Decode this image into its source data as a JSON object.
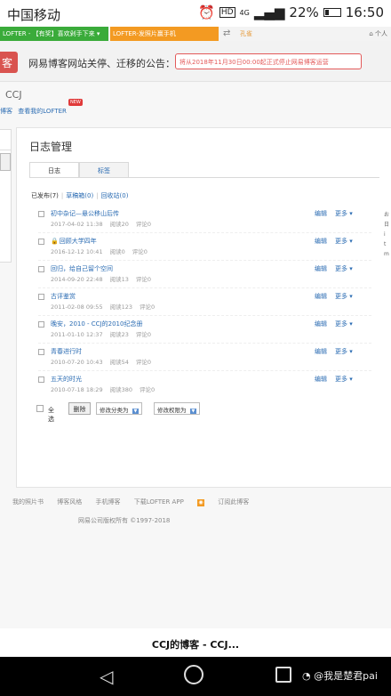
{
  "status_bar": {
    "carrier": "中国移动",
    "network": "4G",
    "battery": "22%",
    "time": "16:50"
  },
  "top_strip": {
    "green_tab": "LOFTER - 【有奖】喜欢剁手下来 ▾",
    "orange_tab": "LOFTER-发照片赢手机",
    "middle": "孔雀",
    "right": "个人"
  },
  "notice": {
    "logo": "客",
    "text": "网易博客网站关停、迁移的公告：",
    "pill": "将从2018年11月30日00:00起正式停止网易博客运营"
  },
  "blog": {
    "name": "CCJ",
    "link1": "博客",
    "link2": "查看我的LOFTER",
    "new_badge": "NEW"
  },
  "main": {
    "title": "日志管理",
    "tabs": [
      "日志",
      "标签"
    ],
    "filters": {
      "published": "已发布(7)",
      "drafts": "草稿箱(0)",
      "trash": "回收站(0)"
    }
  },
  "posts": [
    {
      "title": "初中杂记—悬公移山后传",
      "date": "2017-04-02 11:38",
      "reads": "阅读20",
      "comments": "评论0",
      "locked": false
    },
    {
      "title": "回顾大学四年",
      "date": "2016-12-12 10:41",
      "reads": "阅读0",
      "comments": "评论0",
      "locked": true
    },
    {
      "title": "回归，给自己留个空间",
      "date": "2014-09-20 22:48",
      "reads": "阅读13",
      "comments": "评论0",
      "locked": false
    },
    {
      "title": "古评鉴赏",
      "date": "2011-02-08 09:55",
      "reads": "阅读123",
      "comments": "评论0",
      "locked": false
    },
    {
      "title": "晚安，2010 - CCJ的2010纪念册",
      "date": "2011-01-10 12:37",
      "reads": "阅读23",
      "comments": "评论0",
      "locked": false
    },
    {
      "title": "青春进行时",
      "date": "2010-07-20 10:43",
      "reads": "阅读54",
      "comments": "评论0",
      "locked": false
    },
    {
      "title": "五天的时光",
      "date": "2010-07-18 18:29",
      "reads": "阅读380",
      "comments": "评论0",
      "locked": false
    }
  ],
  "row_actions": {
    "edit": "编辑",
    "more": "更多 ▾"
  },
  "bottom": {
    "select_all": "全选",
    "delete": "删除",
    "change_category": "修改分类为",
    "change_permission": "修改权限为"
  },
  "right_peek": [
    "お",
    "日",
    "i",
    "t",
    "m"
  ],
  "footer": {
    "links": [
      "我的照片书",
      "博客风格",
      "手机博客",
      "下载LOFTER APP",
      "订阅此博客"
    ],
    "copyright": "网易公司版权所有 ©1997-2018"
  },
  "page_title": "CCJ的博客 - CCJ...",
  "watermark": "@我是楚君pai"
}
